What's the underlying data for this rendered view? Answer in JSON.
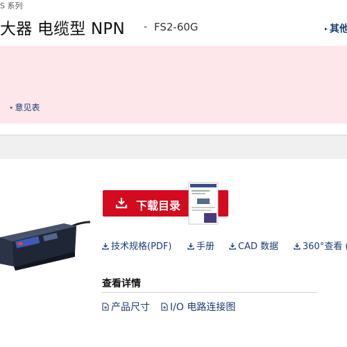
{
  "header": {
    "series_text": "S 系列",
    "title": "大器 电缆型 NPN",
    "dash": "-",
    "model": "FS2-60G",
    "other_link": "其他"
  },
  "notice": {
    "opinion_link": "意见表"
  },
  "product": {
    "download_button": "下载目录"
  },
  "docs": {
    "links": [
      "技术规格(PDF)",
      "手册",
      "CAD 数据",
      "360°查看 ("
    ]
  },
  "details": {
    "heading": "查看详情",
    "links": [
      "产品尺寸",
      "I/O 电路连接图"
    ]
  },
  "colors": {
    "accent_red": "#d40a1e",
    "link_blue": "#1b3a78",
    "notice_bg": "#fde7ea"
  },
  "icons": {
    "download": "download-icon",
    "file": "file-icon",
    "arrow": "triangle-right-icon"
  }
}
